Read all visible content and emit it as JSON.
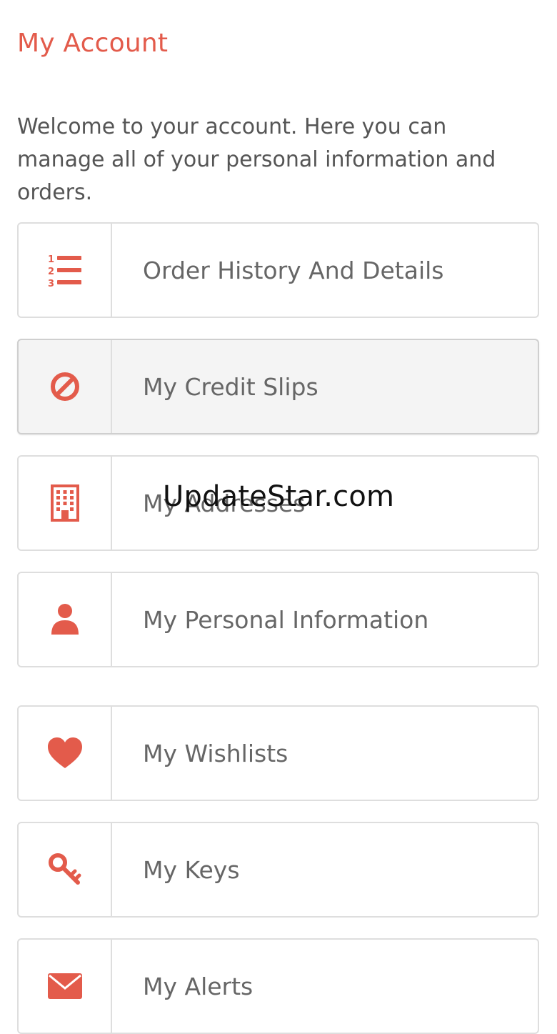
{
  "page": {
    "title": "My Account",
    "intro": "Welcome to your account. Here you can manage all of your personal information and orders."
  },
  "colors": {
    "accent": "#e35b4b",
    "text": "#555555",
    "label": "#666666",
    "border": "#dedede"
  },
  "menu": {
    "items": [
      {
        "label": "Order History And Details",
        "icon": "numbered-list-icon"
      },
      {
        "label": "My Credit Slips",
        "icon": "ban-icon"
      },
      {
        "label": "My Addresses",
        "icon": "building-icon"
      },
      {
        "label": "My Personal Information",
        "icon": "user-icon"
      },
      {
        "label": "My Wishlists",
        "icon": "heart-icon"
      },
      {
        "label": "My Keys",
        "icon": "key-icon"
      },
      {
        "label": "My Alerts",
        "icon": "envelope-icon"
      }
    ]
  },
  "watermark": {
    "text": "UpdateStar.com"
  }
}
